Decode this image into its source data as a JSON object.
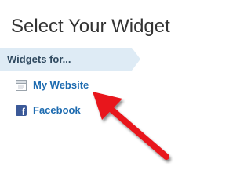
{
  "title": "Select Your Widget",
  "section": {
    "label": "Widgets for..."
  },
  "items": [
    {
      "label": "My Website",
      "icon": "webpage-icon"
    },
    {
      "label": "Facebook",
      "icon": "facebook-icon"
    }
  ],
  "colors": {
    "title": "#333333",
    "header_bg": "#deebf5",
    "header_text": "#304a60",
    "link": "#1d6bb0",
    "facebook": "#3b5998",
    "arrow": "#e8161b"
  }
}
